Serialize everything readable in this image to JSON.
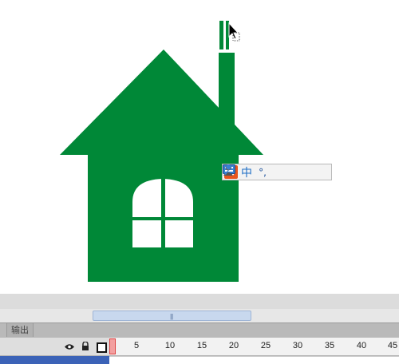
{
  "stage": {
    "house_color": "#008837",
    "window_color": "#ffffff",
    "cursor_icon": "arrow-cursor-icon"
  },
  "ime_toolbar": {
    "logo": "S",
    "mode": "中",
    "moon_icon": "moon-icon",
    "punct": "°,",
    "keyboard_icon": "keyboard-icon",
    "user_icon": "user-icon",
    "wrench_icon": "wrench-icon"
  },
  "panel": {
    "output_tab": "输出"
  },
  "timeline": {
    "ruler_labels": [
      "5",
      "10",
      "15",
      "20",
      "25",
      "30",
      "35",
      "40",
      "45"
    ]
  }
}
